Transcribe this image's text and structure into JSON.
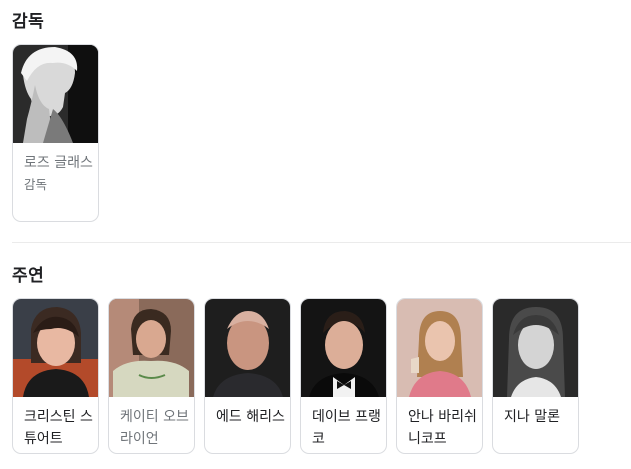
{
  "director_section": {
    "title": "감독",
    "people": [
      {
        "name": "로즈 글래스",
        "role": "감독"
      }
    ]
  },
  "cast_section": {
    "title": "주연",
    "people": [
      {
        "name": "크리스틴 스튜어트"
      },
      {
        "name": "케이티 오브라이언"
      },
      {
        "name": "에드 해리스"
      },
      {
        "name": "데이브 프랭코"
      },
      {
        "name": "안나 바리쉬니코프"
      },
      {
        "name": "지나 말론"
      }
    ]
  }
}
